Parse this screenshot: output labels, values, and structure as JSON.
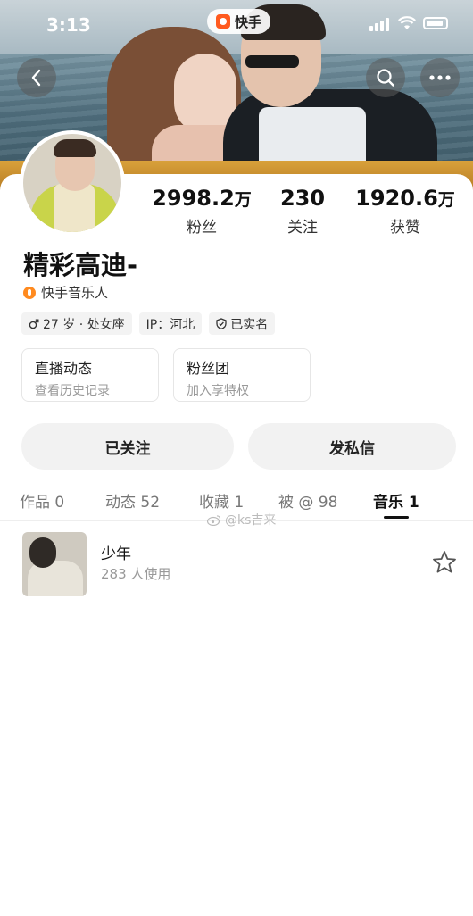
{
  "status_bar": {
    "time": "3:13"
  },
  "app": {
    "name": "快手"
  },
  "profile": {
    "name": "精彩高迪-",
    "badge": "快手音乐人",
    "stats": [
      {
        "value": "2998.2",
        "unit": "万",
        "label": "粉丝"
      },
      {
        "value": "230",
        "unit": "",
        "label": "关注"
      },
      {
        "value": "1920.6",
        "unit": "万",
        "label": "获赞"
      }
    ],
    "tags": [
      {
        "icon": "male-icon",
        "text": "27 岁 · 处女座"
      },
      {
        "icon": "",
        "text": "IP：河北"
      },
      {
        "icon": "shield-icon",
        "text": "已实名"
      }
    ],
    "entries": [
      {
        "title": "直播动态",
        "subtitle": "查看历史记录"
      },
      {
        "title": "粉丝团",
        "subtitle": "加入享特权"
      }
    ],
    "buttons": {
      "followed": "已关注",
      "message": "发私信"
    }
  },
  "tabs": [
    {
      "label": "作品 0"
    },
    {
      "label": "动态 52"
    },
    {
      "label": "收藏 1"
    },
    {
      "label": "被 @ 98"
    },
    {
      "label": "音乐 1",
      "active": true
    }
  ],
  "watermark": "@ks吉来",
  "music_list": [
    {
      "title": "少年",
      "usage": "283 人使用"
    }
  ],
  "colors": {
    "accent": "#ff5a1f",
    "badge": "#ff8a1f"
  }
}
